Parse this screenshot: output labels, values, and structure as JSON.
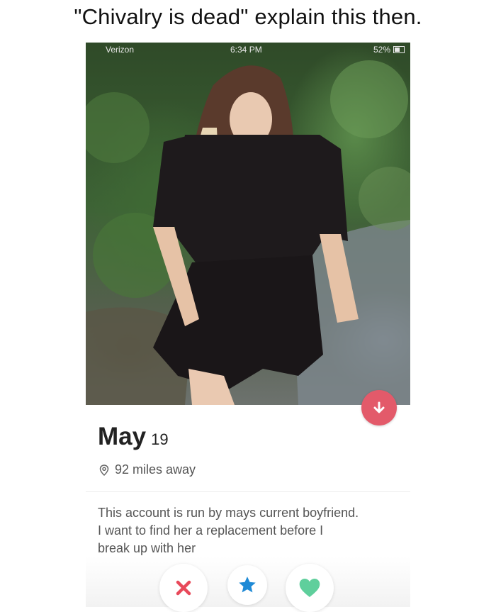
{
  "caption": "\"Chivalry is dead\" explain this then.",
  "status_bar": {
    "carrier": "Verizon",
    "time": "6:34 PM",
    "battery": "52%"
  },
  "profile": {
    "name": "May",
    "age": "19",
    "distance": "92 miles away",
    "bio_lines": [
      "This account is run by mays current boyfriend.",
      "I want to find her a replacement before I",
      "break up with her"
    ]
  },
  "colors": {
    "dislike_button": "#e35a6a",
    "nope_icon": "#e8495a",
    "super_like_icon": "#1f8ad6",
    "like_icon": "#5fcf9c"
  },
  "icons": {
    "info": "arrow-down-icon",
    "location": "location-pin-icon",
    "nope": "close-icon",
    "super_like": "star-icon",
    "like": "heart-icon"
  }
}
